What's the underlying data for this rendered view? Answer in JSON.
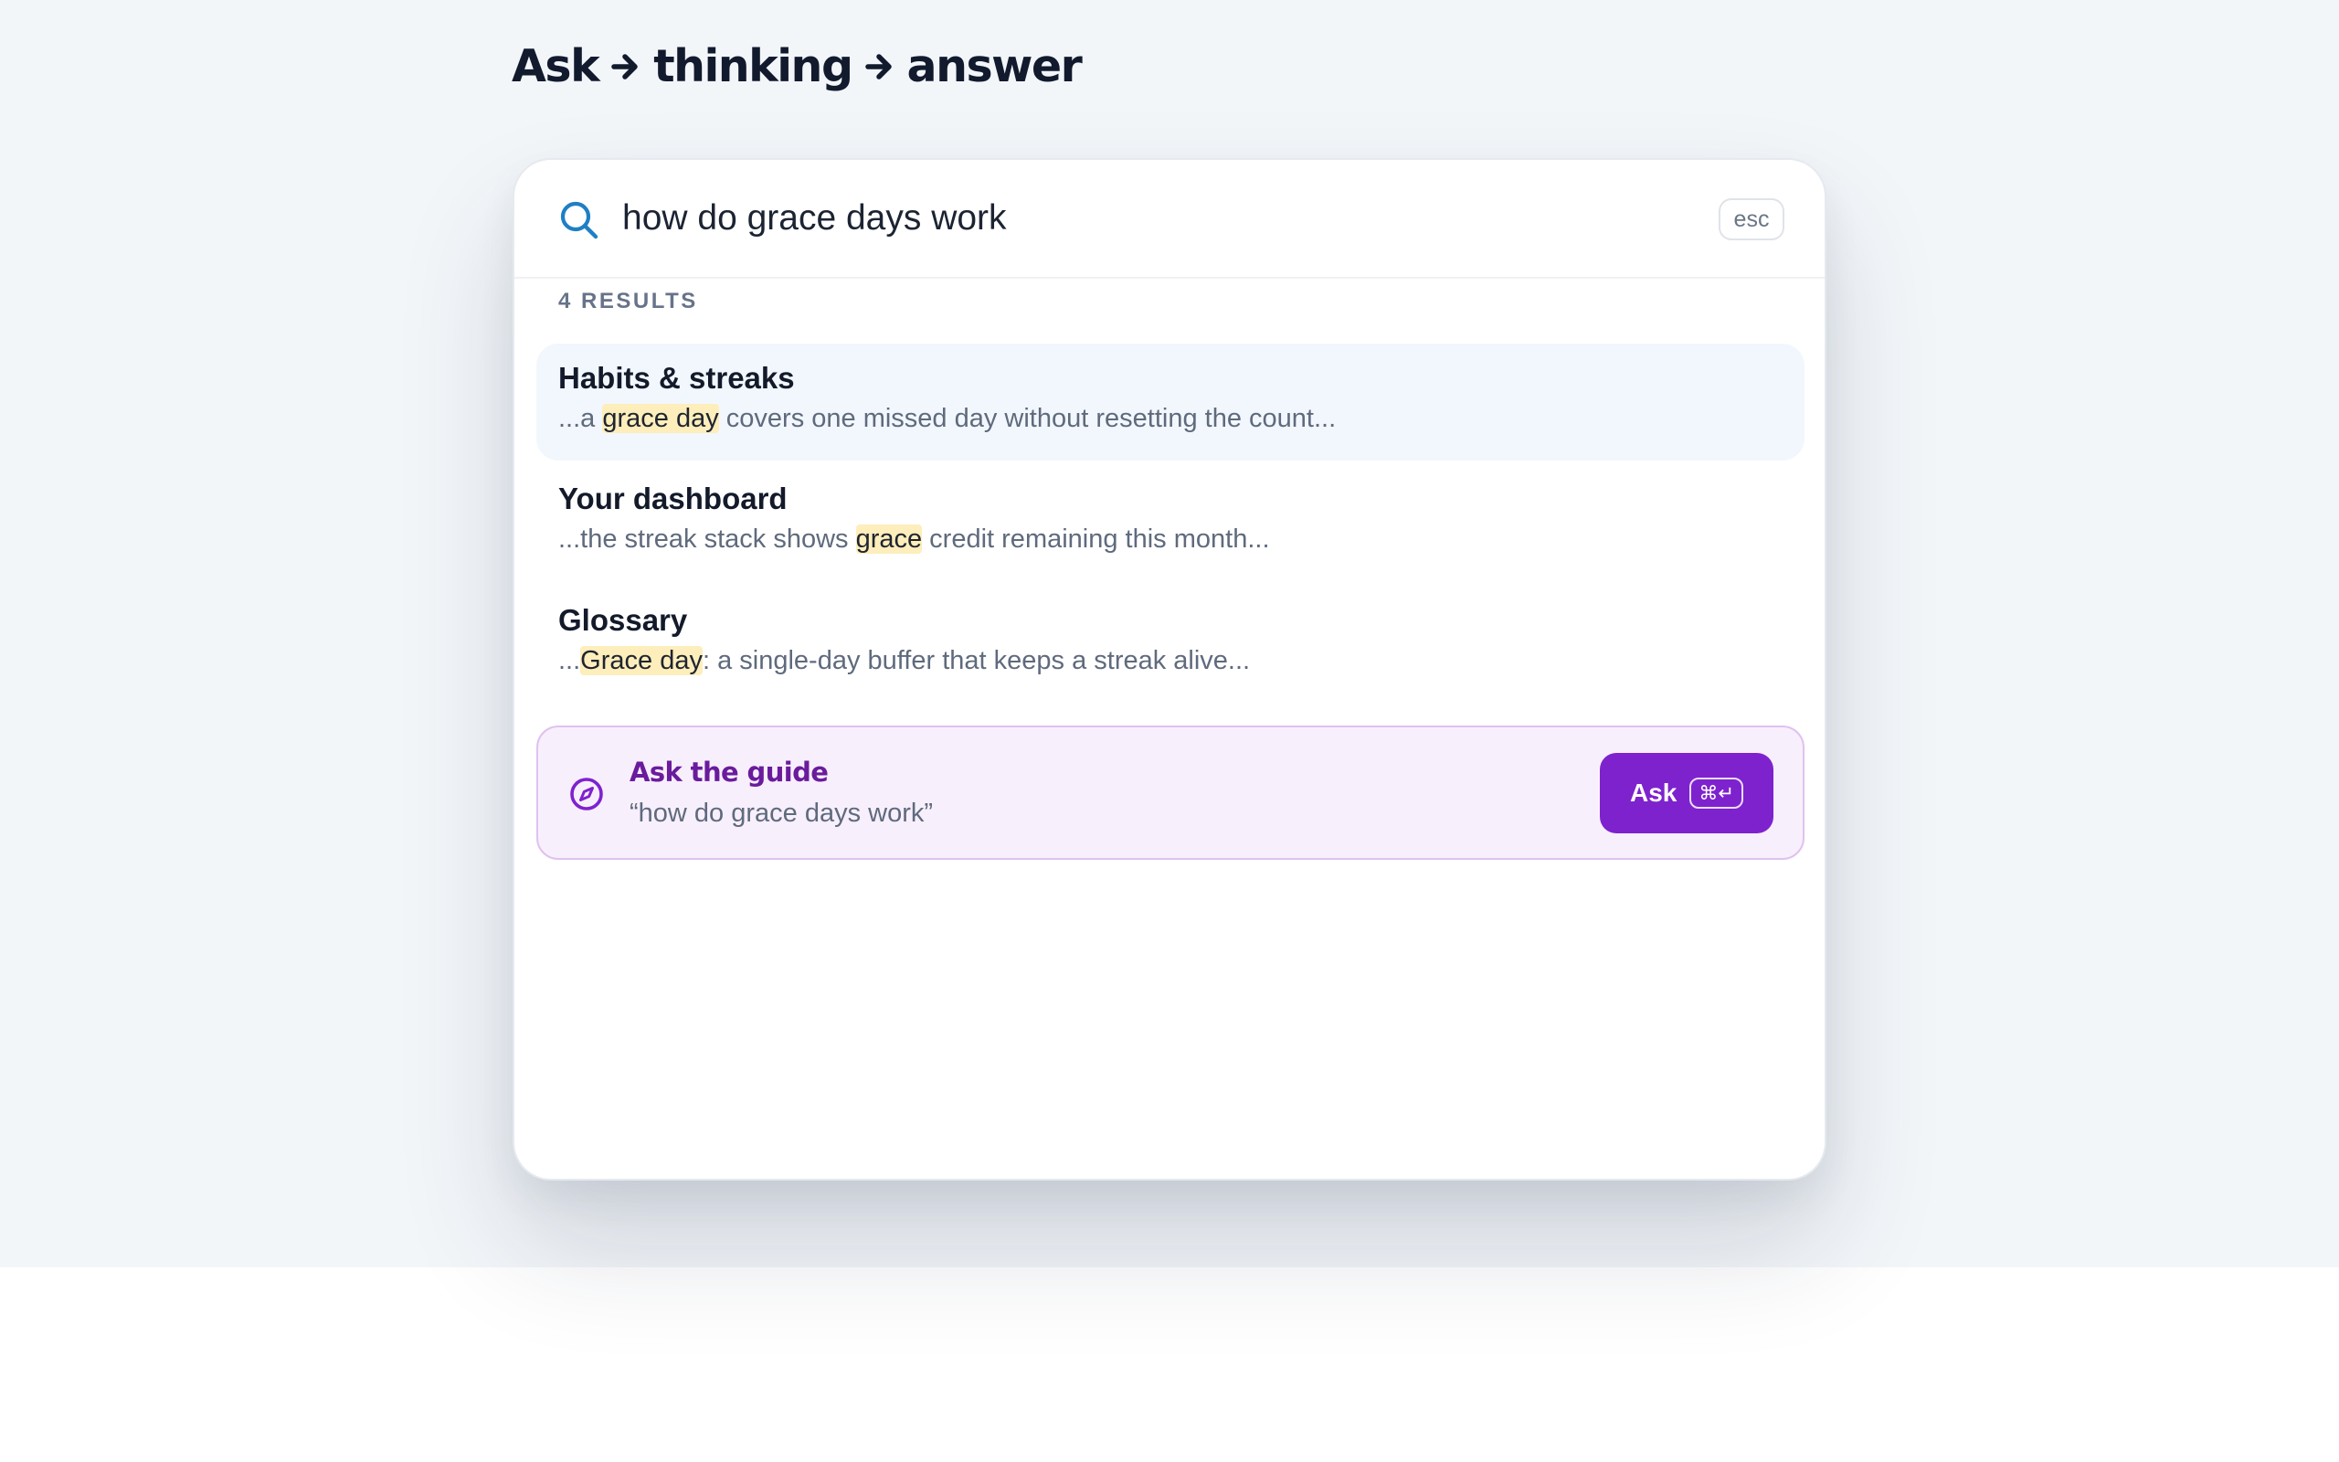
{
  "heading": {
    "part1": "Ask",
    "part2": "thinking",
    "part3": "answer"
  },
  "search": {
    "query": "how do grace days work",
    "esc_label": "esc",
    "icon": "search-icon"
  },
  "results": {
    "count_label": "4 RESULTS",
    "items": [
      {
        "title": "Habits & streaks",
        "snippet_before": "...a ",
        "snippet_match": "grace day",
        "snippet_after": " covers one missed day without resetting the count...",
        "active": true
      },
      {
        "title": "Your dashboard",
        "snippet_before": "...the streak stack shows ",
        "snippet_match": "grace",
        "snippet_after": " credit remaining this month...",
        "active": false
      },
      {
        "title": "Glossary",
        "snippet_before": "...",
        "snippet_match": "Grace day",
        "snippet_after": ": a single-day buffer that keeps a streak alive...",
        "active": false
      }
    ]
  },
  "ask": {
    "title": "Ask the guide",
    "query": "“how do grace days work”",
    "button_label": "Ask",
    "shortcut": "⌘↵",
    "icon": "compass-icon"
  },
  "colors": {
    "accent": "#7e22ce",
    "search_icon": "#1f7fc4",
    "highlight": "#fdeebb",
    "heading": "#121a2e",
    "ask_card_bg": "#f8effc"
  }
}
